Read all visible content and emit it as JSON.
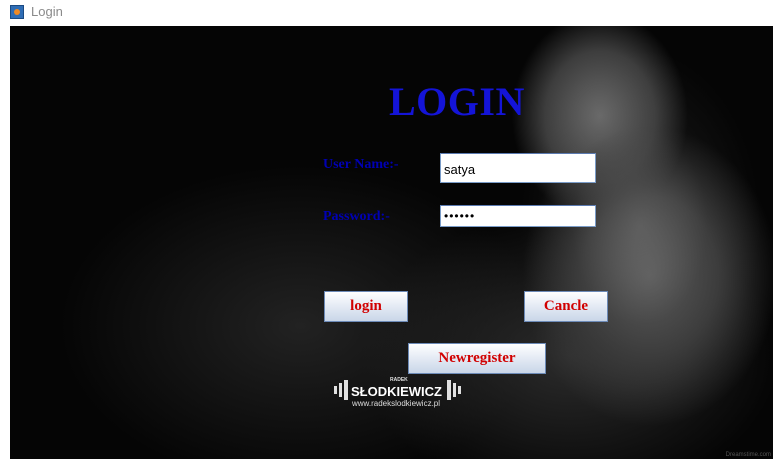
{
  "window": {
    "title": "Login",
    "icon": "java-cup-icon"
  },
  "form": {
    "heading": "LOGIN",
    "username_label": "User Name:-",
    "username_value": "satya",
    "password_label": "Password:-",
    "password_masked": "••••••"
  },
  "buttons": {
    "login": "login",
    "cancel": "Cancle",
    "register": "Newregister"
  },
  "background": {
    "brand_small": "RADEK",
    "brand_name": "SŁODKIEWICZ",
    "brand_url": "www.radekslodkiewicz.pl",
    "watermark": "Dreamstime.com"
  },
  "colors": {
    "heading": "#1414d8",
    "label": "#0000b4",
    "button_text": "#d10000"
  }
}
